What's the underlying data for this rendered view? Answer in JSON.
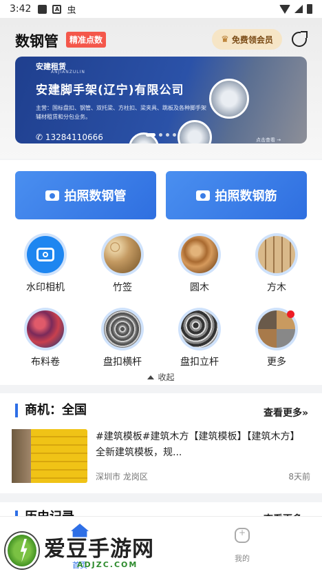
{
  "status_bar": {
    "time": "3:42",
    "a_icon": "A",
    "bug_icon": "虫"
  },
  "header": {
    "title": "数钢管",
    "badge": "精准点数",
    "vip_button": "免费领会员",
    "share_icon": "share-icon"
  },
  "banner": {
    "logo": "安建租赁",
    "logo_sub": "ANJIANZULIN",
    "company": "安建脚手架(辽宁)有限公司",
    "description": "主营：国标盘扣、钢管、双托梁、方柱扣、梁夹具、跳板及各种脚手架辅材租赁和分包业务。",
    "phone": "13284110666",
    "more": "点击查看 →",
    "slides": 4,
    "active_slide": 1
  },
  "actions": [
    {
      "label": "拍照数钢管"
    },
    {
      "label": "拍照数钢筋"
    }
  ],
  "grid": [
    {
      "label": "水印相机",
      "icon": "camera-icon"
    },
    {
      "label": "竹签",
      "icon": "bamboo-icon"
    },
    {
      "label": "圆木",
      "icon": "log-icon"
    },
    {
      "label": "方木",
      "icon": "square-timber-icon"
    },
    {
      "label": "布料卷",
      "icon": "fabric-roll-icon"
    },
    {
      "label": "盘扣横杆",
      "icon": "horizontal-rod-icon"
    },
    {
      "label": "盘扣立杆",
      "icon": "vertical-rod-icon"
    },
    {
      "label": "更多",
      "icon": "more-icon"
    }
  ],
  "collapse_label": "收起",
  "business": {
    "title": "商机：全国",
    "see_more": "查看更多»",
    "item": {
      "text": "#建筑模板#建筑木方【建筑模板】【建筑木方】全新建筑模板，规...",
      "location": "深圳市 龙岗区",
      "time": "8天前"
    }
  },
  "history": {
    "title": "历史记录",
    "see_more": "查看更多»"
  },
  "bottom_nav": [
    {
      "label": "首页"
    },
    {
      "label": "我的"
    }
  ],
  "watermark": {
    "brand": "爱豆手游网",
    "url": "ADJZC.COM"
  },
  "colors": {
    "accent": "#2e6fe6",
    "badge": "#f4574b",
    "vip": "#f6e5c6"
  }
}
